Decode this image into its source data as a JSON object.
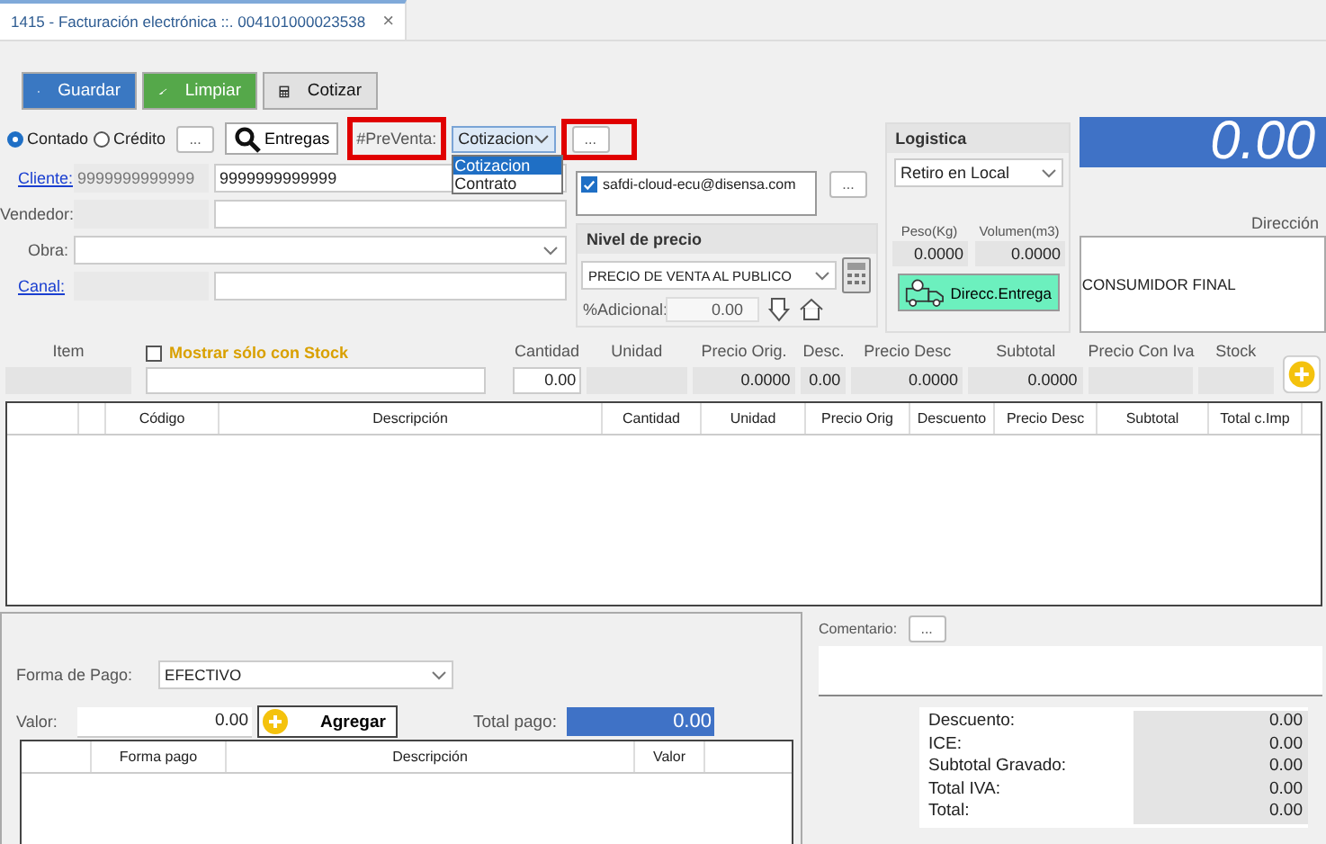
{
  "tab": {
    "title": "1415 - Facturación electrónica ::. 004101000023538",
    "close": "×"
  },
  "toolbar": [
    {
      "label": "Guardar",
      "kind": "save"
    },
    {
      "label": "Limpiar",
      "kind": "clear"
    },
    {
      "label": "Cotizar",
      "kind": "quote"
    }
  ],
  "sale_type": [
    {
      "label": "Contado",
      "selected": true
    },
    {
      "label": "Crédito",
      "selected": false
    }
  ],
  "sale_type_more": "...",
  "deliveries_button": "Entregas",
  "preventa": {
    "label": "#PreVenta:",
    "value": "Cotizacion",
    "more": "...",
    "options": [
      {
        "label": "Cotizacion",
        "selected": true
      },
      {
        "label": "Contrato",
        "selected": false
      }
    ]
  },
  "fields": [
    {
      "label": "Cliente:",
      "kind": "link",
      "code": "9999999999999",
      "value": "9999999999999"
    },
    {
      "label": "Vendedor:",
      "kind": "text"
    },
    {
      "label": "Obra:",
      "kind": "select"
    },
    {
      "label": "Canal:",
      "kind": "link"
    }
  ],
  "emails": [
    {
      "address": "safdi-cloud-ecu@disensa.com",
      "checked": true
    }
  ],
  "emails_more": "...",
  "price_level": {
    "title": "Nivel de precio",
    "value": "PRECIO DE VENTA AL PUBLICO",
    "additional_label": "%Adicional:",
    "additional_value": "0.00"
  },
  "logistics": {
    "title": "Logistica",
    "mode": "Retiro en Local",
    "weight_label": "Peso(Kg)",
    "weight": "0.0000",
    "volume_label": "Volumen(m3)",
    "volume": "0.0000",
    "delivery_button": "Direcc.Entrega"
  },
  "total": "0.00",
  "address": {
    "label": "Dirección",
    "value": "CONSUMIDOR FINAL"
  },
  "item_entry": {
    "item_label": "Item",
    "stock_filter": {
      "label": "Mostrar sólo con Stock",
      "checked": false
    },
    "columns": [
      {
        "label": "Cantidad",
        "value": "0.00",
        "kind": "input"
      },
      {
        "label": "Unidad",
        "kind": "readonly"
      },
      {
        "label": "Precio Orig.",
        "value": "0.0000",
        "kind": "readonly"
      },
      {
        "label": "Desc.",
        "value": "0.00",
        "kind": "readonly"
      },
      {
        "label": "Precio Desc",
        "value": "0.0000",
        "kind": "readonly"
      },
      {
        "label": "Subtotal",
        "value": "0.0000",
        "kind": "readonly"
      },
      {
        "label": "Precio Con Iva",
        "kind": "readonly"
      },
      {
        "label": "Stock",
        "kind": "readonly"
      }
    ]
  },
  "table": {
    "columns": [
      "Código",
      "Descripción",
      "Cantidad",
      "Unidad",
      "Precio Orig",
      "Descuento",
      "Precio Desc",
      "Subtotal",
      "Total c.Imp"
    ]
  },
  "payment": {
    "method_label": "Forma de Pago:",
    "method": "EFECTIVO",
    "amount_label": "Valor:",
    "amount": "0.00",
    "add_button": "Agregar",
    "total_label": "Total pago:",
    "total": "0.00",
    "columns": [
      "Forma pago",
      "Descripción",
      "Valor"
    ]
  },
  "comment": {
    "label": "Comentario:",
    "more": "..."
  },
  "summary": [
    {
      "label": "Descuento:",
      "value": "0.00"
    },
    {
      "label": "ICE:",
      "value": "0.00"
    },
    {
      "label": "Subtotal Gravado:",
      "value": "0.00"
    },
    {
      "label": "Total IVA:",
      "value": "0.00"
    },
    {
      "label": "Total:",
      "value": "0.00"
    }
  ]
}
